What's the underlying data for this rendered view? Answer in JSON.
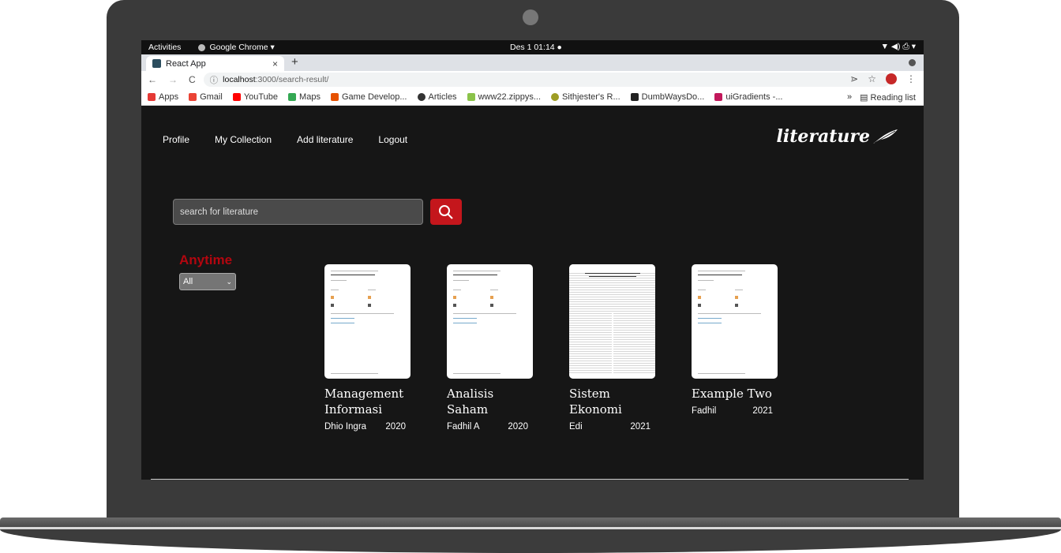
{
  "os": {
    "activities": "Activities",
    "app_name": "Google Chrome ▾",
    "clock": "Des 1  01:14",
    "tray": "▼  ◀)  ⎙  ▾"
  },
  "browser": {
    "tab_title": "React App",
    "tab_close": "×",
    "new_tab": "+",
    "back": "←",
    "forward": "→",
    "reload": "C",
    "url_host": "localhost",
    "url_path": ":3000/search-result/",
    "share": "⋗",
    "star": "☆",
    "more": "⋮",
    "bookmarks": [
      {
        "label": "Apps",
        "color": "#e53935"
      },
      {
        "label": "Gmail",
        "color": "#ea4335"
      },
      {
        "label": "YouTube",
        "color": "#ff0000"
      },
      {
        "label": "Maps",
        "color": "#34a853"
      },
      {
        "label": "Game Develop...",
        "color": "#e65100"
      },
      {
        "label": "Articles",
        "color": "#333333"
      },
      {
        "label": "www22.zippys...",
        "color": "#8bc34a"
      },
      {
        "label": "Sithjester's R...",
        "color": "#9e9d24"
      },
      {
        "label": "DumbWaysDo...",
        "color": "#222222"
      },
      {
        "label": "uiGradients -...",
        "color": "#c2185b"
      }
    ],
    "bookmarks_more": "»",
    "reading_list": "Reading list"
  },
  "nav": {
    "items": [
      "Profile",
      "My Collection",
      "Add literature",
      "Logout"
    ],
    "brand": "literature"
  },
  "search": {
    "placeholder": "search for literature"
  },
  "filter": {
    "title": "Anytime",
    "selected": "All"
  },
  "results": [
    {
      "title": "Management Informasi",
      "author": "Dhio Ingra",
      "year": "2020"
    },
    {
      "title": "Analisis Saham",
      "author": "Fadhil A",
      "year": "2020"
    },
    {
      "title": "Sistem Ekonomi",
      "author": "Edi",
      "year": "2021"
    },
    {
      "title": "Example Two",
      "author": "Fadhil",
      "year": "2021"
    }
  ],
  "colors": {
    "background": "#161616",
    "accent": "#b3060f",
    "search_button": "#c4161c"
  }
}
